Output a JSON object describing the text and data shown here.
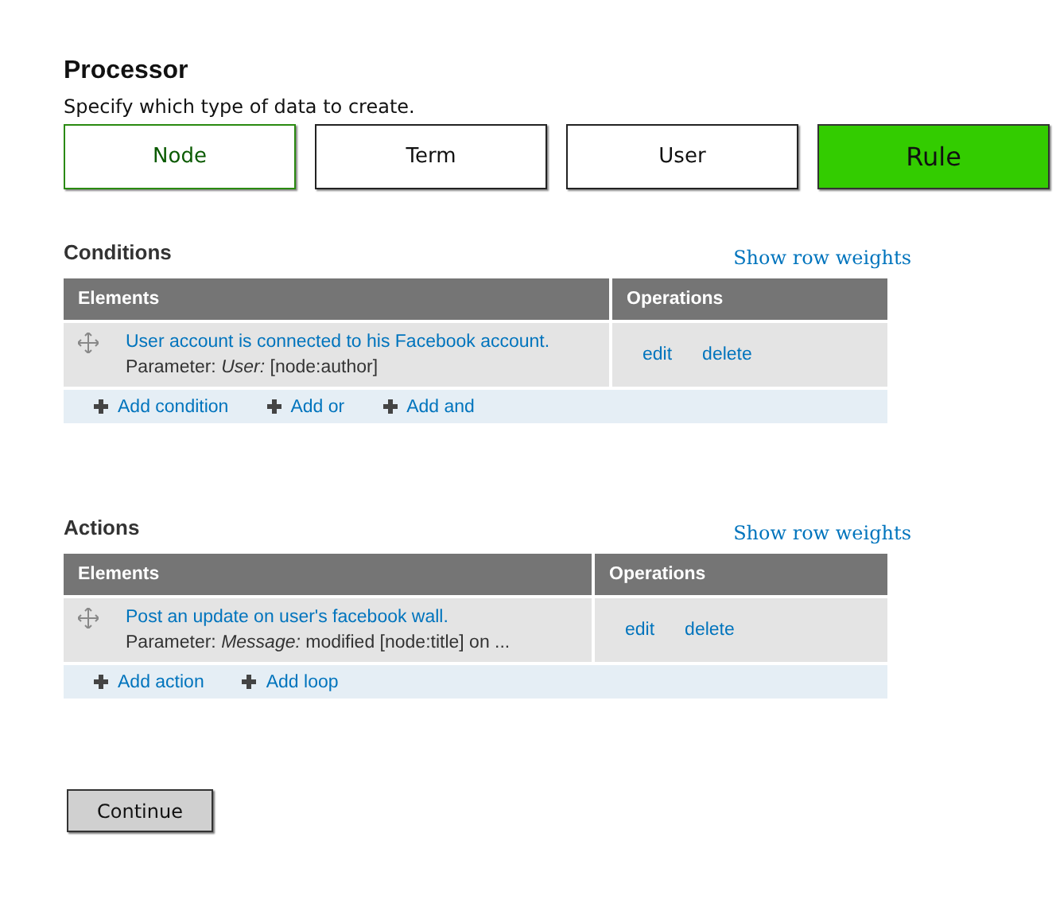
{
  "title": "Processor",
  "description": "Specify which type of data to create.",
  "types": [
    {
      "label": "Node",
      "selected": false,
      "hovered": true
    },
    {
      "label": "Term",
      "selected": false,
      "hovered": false
    },
    {
      "label": "User",
      "selected": false,
      "hovered": false
    },
    {
      "label": "Rule",
      "selected": true,
      "hovered": false
    }
  ],
  "sections": [
    {
      "heading": "Conditions",
      "weights_link": "Show row weights",
      "columns": [
        "Elements",
        "Operations"
      ],
      "rows": [
        {
          "link": "User account is connected to his Facebook account.",
          "parameter": "Parameter: *User:* [node:author]",
          "operations": [
            "edit",
            "delete"
          ]
        }
      ],
      "add_links": [
        "Add condition",
        "Add or",
        "Add and"
      ]
    },
    {
      "heading": "Actions",
      "weights_link": "Show row weights",
      "columns": [
        "Elements",
        "Operations"
      ],
      "rows": [
        {
          "link": "Post an update on user's facebook wall.",
          "parameter": "Parameter: *Message:* modified [node:title] on ...",
          "operations": [
            "edit",
            "delete"
          ]
        }
      ],
      "add_links": [
        "Add action",
        "Add loop"
      ]
    }
  ],
  "continue_button": "Continue"
}
